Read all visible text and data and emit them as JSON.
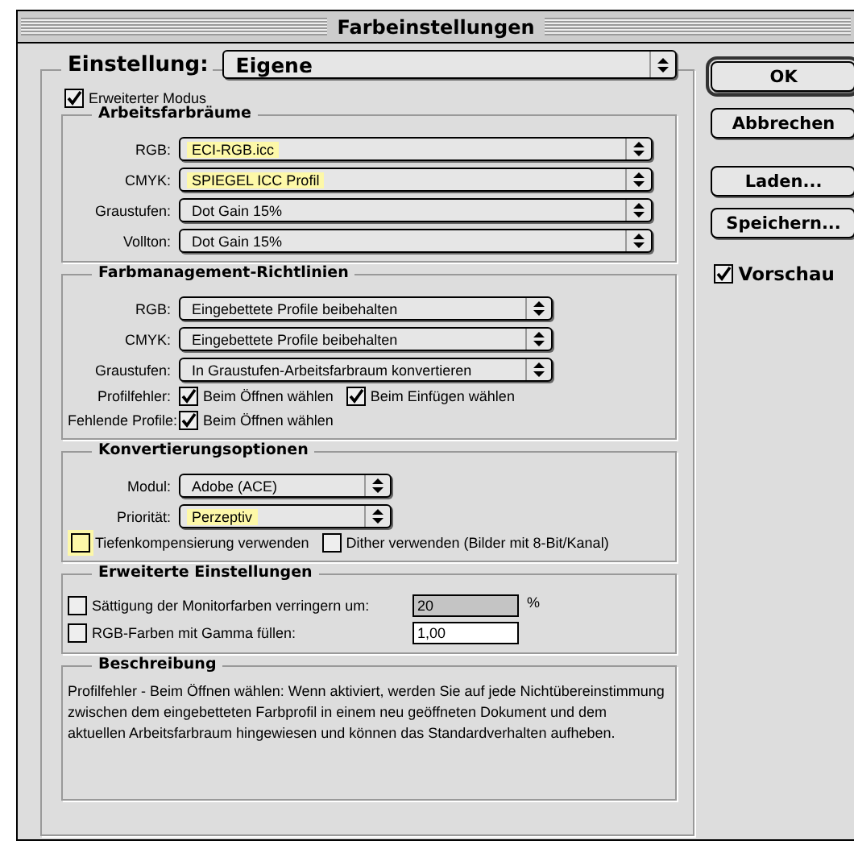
{
  "window": {
    "title": "Farbeinstellungen"
  },
  "setting": {
    "label": "Einstellung:",
    "value": "Eigene"
  },
  "advanced_mode": {
    "label": "Erweiterter Modus",
    "checked": true
  },
  "working_spaces": {
    "title": "Arbeitsfarbräume",
    "rows": [
      {
        "label": "RGB:",
        "value": "ECI-RGB.icc",
        "highlighted": true
      },
      {
        "label": "CMYK:",
        "value": "SPIEGEL ICC Profil",
        "highlighted": true
      },
      {
        "label": "Graustufen:",
        "value": "Dot Gain 15%",
        "highlighted": false
      },
      {
        "label": "Vollton:",
        "value": "Dot Gain 15%",
        "highlighted": false
      }
    ]
  },
  "policies": {
    "title": "Farbmanagement-Richtlinien",
    "rows": [
      {
        "label": "RGB:",
        "value": "Eingebettete Profile beibehalten",
        "highlighted": false
      },
      {
        "label": "CMYK:",
        "value": "Eingebettete Profile beibehalten",
        "highlighted": false
      },
      {
        "label": "Graustufen:",
        "value": "In Graustufen-Arbeitsfarbraum konvertieren",
        "highlighted": false
      }
    ],
    "checks": [
      {
        "label": "Profilfehler:",
        "options": [
          {
            "label": "Beim Öffnen wählen",
            "checked": true
          },
          {
            "label": "Beim Einfügen wählen",
            "checked": true
          }
        ]
      },
      {
        "label": "Fehlende Profile:",
        "options": [
          {
            "label": "Beim Öffnen wählen",
            "checked": true
          }
        ]
      }
    ]
  },
  "conversion": {
    "title": "Konvertierungsoptionen",
    "rows": [
      {
        "label": "Modul:",
        "value": "Adobe (ACE)",
        "highlighted": false
      },
      {
        "label": "Priorität:",
        "value": "Perzeptiv",
        "highlighted": true
      }
    ],
    "options": [
      {
        "label": "Tiefenkompensierung verwenden",
        "checked": false,
        "highlighted": true
      },
      {
        "label": "Dither verwenden (Bilder mit 8-Bit/Kanal)",
        "checked": false,
        "highlighted": false
      }
    ]
  },
  "advanced": {
    "title": "Erweiterte Einstellungen",
    "rows": [
      {
        "label": "Sättigung der Monitorfarben verringern um:",
        "checked": false,
        "value": "20",
        "disabled": true,
        "unit": "%"
      },
      {
        "label": "RGB-Farben mit Gamma füllen:",
        "checked": false,
        "value": "1,00",
        "disabled": false
      }
    ]
  },
  "description": {
    "title": "Beschreibung",
    "text": "Profilfehler - Beim Öffnen wählen: Wenn aktiviert, werden Sie auf jede Nichtübereinstimmung zwischen dem eingebetteten Farbprofil in einem neu geöffneten Dokument und dem aktuellen Arbeitsfarbraum hingewiesen und können das Standardverhalten aufheben."
  },
  "buttons": [
    {
      "label": "OK",
      "default": true
    },
    {
      "label": "Abbrechen",
      "default": false
    },
    {
      "label": "Laden...",
      "default": false
    },
    {
      "label": "Speichern...",
      "default": false
    }
  ],
  "preview": {
    "label": "Vorschau",
    "checked": true
  }
}
